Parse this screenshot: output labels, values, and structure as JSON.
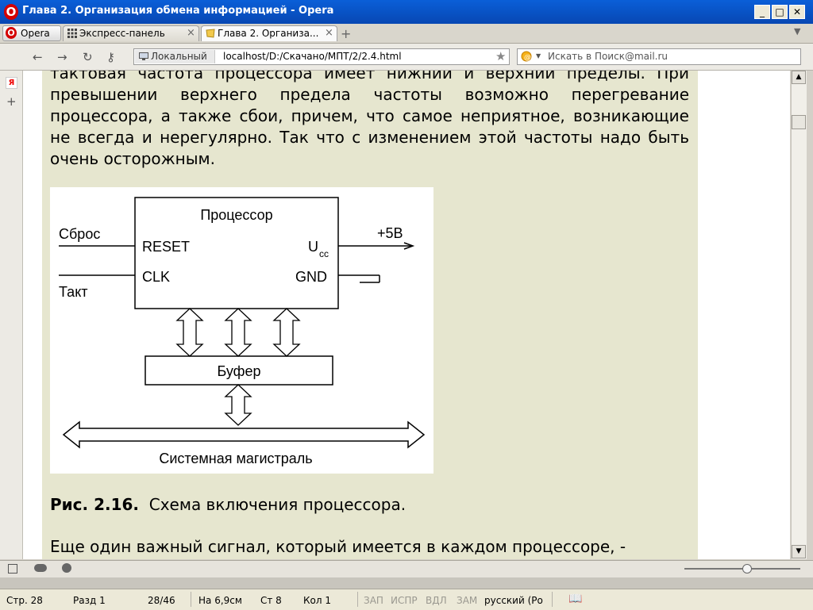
{
  "window": {
    "title": "Глава 2. Организация обмена информацией - Opera"
  },
  "tabs": {
    "opera_menu": "Opera",
    "items": [
      {
        "label": "Экспресс-панель"
      },
      {
        "label": "Глава 2. Организа..."
      }
    ]
  },
  "address": {
    "badge": "Локальный",
    "url": "localhost/D:/Скачано/МПТ/2/2.4.html",
    "search_placeholder": "Искать в Поиск@mail.ru"
  },
  "article": {
    "paragraph_top": "тактовая частота процессора имеет нижний и верхний пределы. При превышении верхнего предела частоты возможно перегревание процессора, а также сбои, причем, что самое неприятное, возникающие не всегда и нерегулярно. Так что с изменением этой частоты надо быть очень осторожным.",
    "figure": {
      "cpu_title": "Процессор",
      "reset_in": "Сброс",
      "reset_pin": "RESET",
      "clk_in": "Такт",
      "clk_pin": "CLK",
      "ucc_pin": "U",
      "ucc_sub": "cc",
      "gnd_pin": "GND",
      "power": "+5В",
      "buffer": "Буфер",
      "bus": "Системная магистраль"
    },
    "caption_label": "Рис. 2.16.",
    "caption_text": "Схема включения процессора.",
    "paragraph_bottom": "Еще один важный сигнал, который имеется в каждом процессоре, -"
  },
  "word_status": {
    "page": "Стр. 28",
    "section": "Разд 1",
    "pages": "28/46",
    "position": "На 6,9см",
    "line": "Ст 8",
    "column": "Кол 1",
    "rec": "ЗАП",
    "trk": "ИСПР",
    "ext": "ВДЛ",
    "ovr": "ЗАМ",
    "language": "русский (Ро"
  },
  "colors": {
    "titlebar": "#0a5fd8",
    "article_bg": "#e6e6cf",
    "opera_red": "#d40000"
  }
}
